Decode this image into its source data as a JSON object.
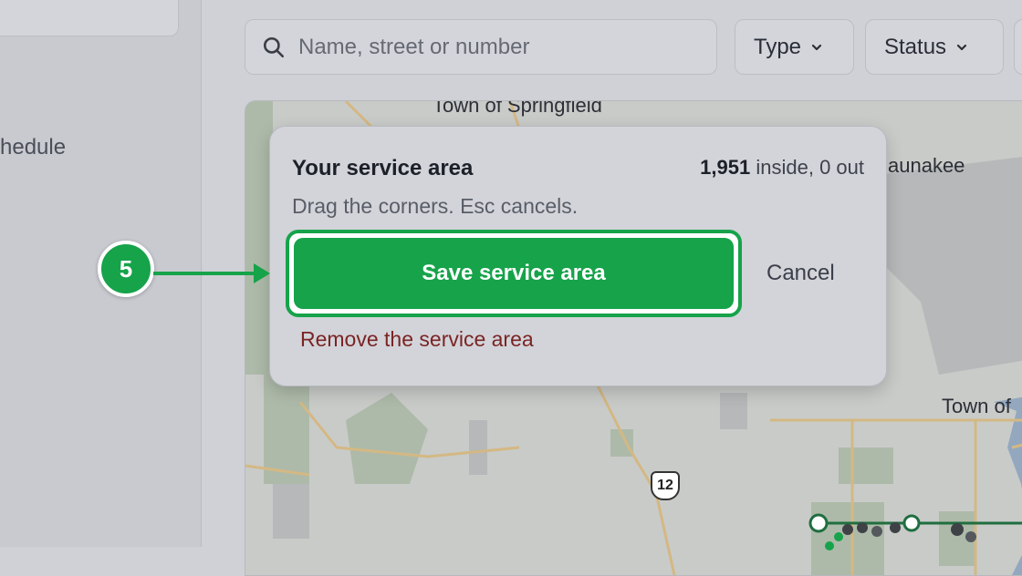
{
  "sidebar": {
    "partial_item_label": "hedule"
  },
  "search": {
    "placeholder": "Name, street or number",
    "icon": "search-icon"
  },
  "filters": [
    {
      "label": "Type"
    },
    {
      "label": "Status"
    }
  ],
  "map": {
    "labels": {
      "town_springfield": "Town of Springfield",
      "waunakee": "aunakee",
      "town_of_right": "Town of",
      "route_shield": "12"
    }
  },
  "popup": {
    "title": "Your service area",
    "count_inside": "1,951",
    "count_rest": "inside, 0 out",
    "hint": "Drag the corners. Esc cancels.",
    "save_label": "Save service area",
    "cancel_label": "Cancel",
    "remove_label": "Remove the service area"
  },
  "step": {
    "number": "5"
  },
  "colors": {
    "accent": "#16a34a",
    "danger_text": "#7b2424"
  }
}
